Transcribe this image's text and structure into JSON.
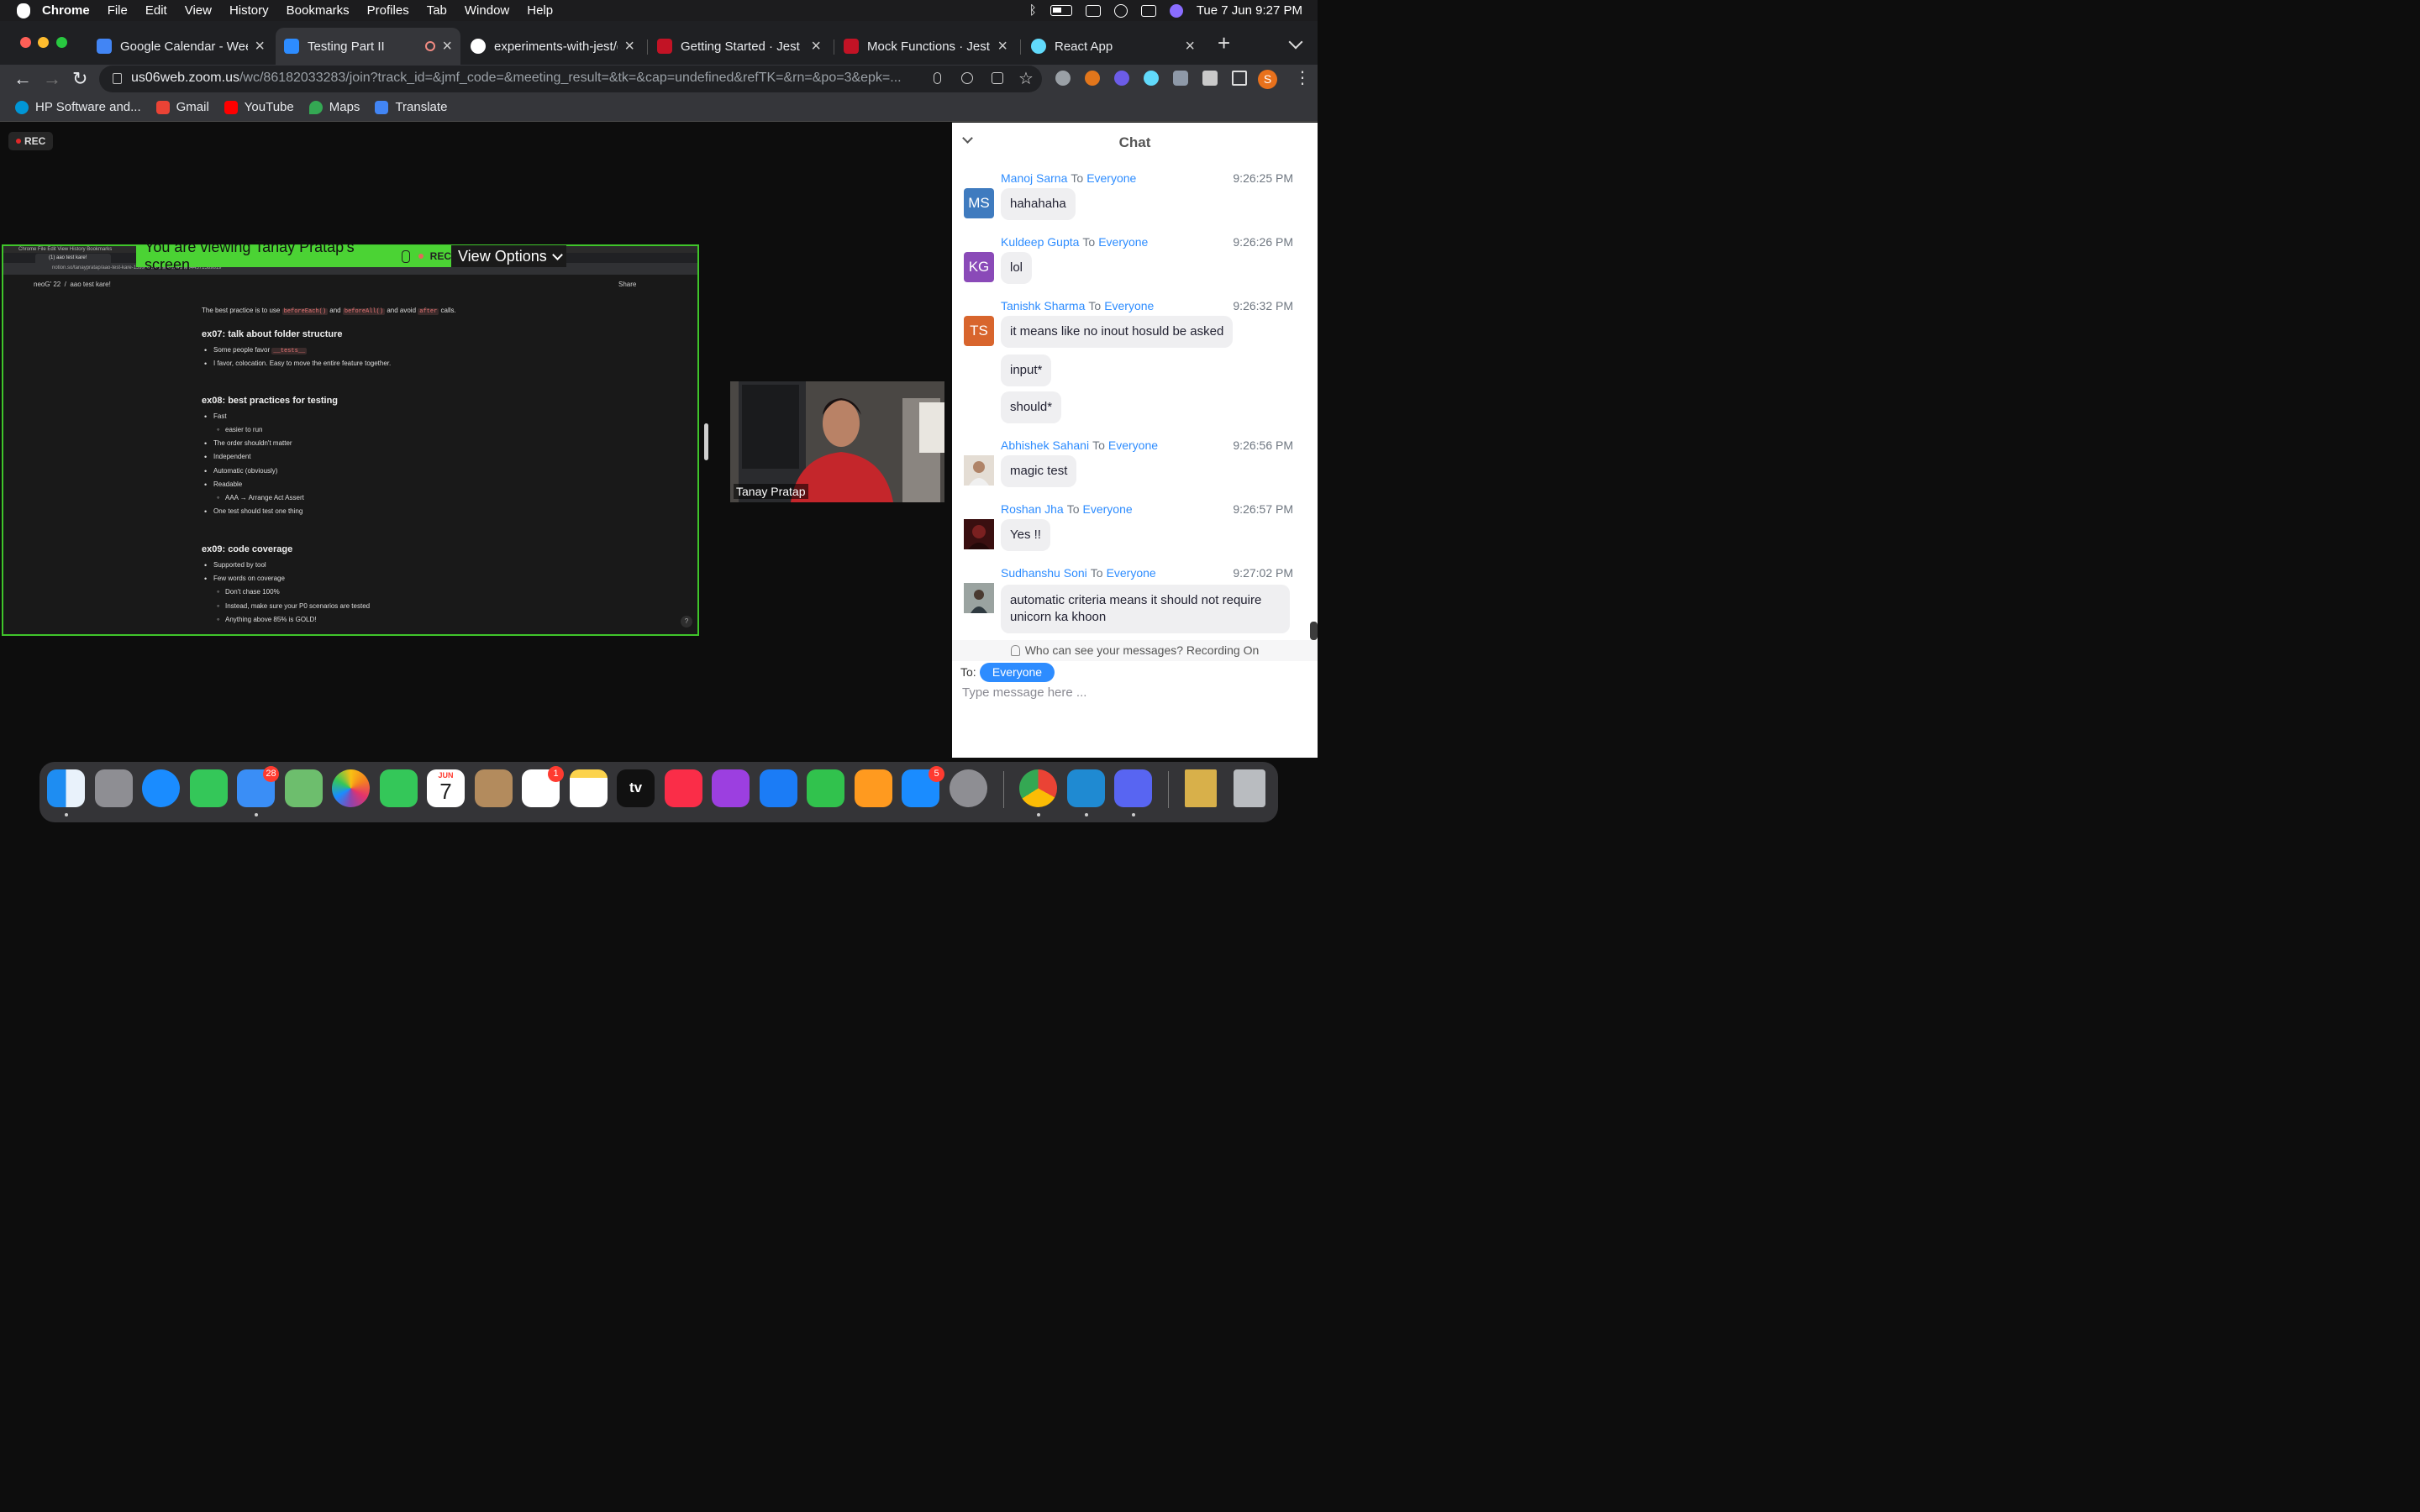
{
  "menubar": {
    "app": "Chrome",
    "items": [
      "File",
      "Edit",
      "View",
      "History",
      "Bookmarks",
      "Profiles",
      "Tab",
      "Window",
      "Help"
    ],
    "clock": "Tue 7 Jun  9:27 PM"
  },
  "tabs": [
    {
      "title": "Google Calendar - Week",
      "favicon_color": "#4285f4",
      "active": false
    },
    {
      "title": "Testing Part II",
      "favicon_color": "#2d8cff",
      "active": true
    },
    {
      "title": "experiments-with-jest/gr",
      "favicon_color": "#ffffff",
      "active": false
    },
    {
      "title": "Getting Started · Jest",
      "favicon_color": "#c21325",
      "active": false
    },
    {
      "title": "Mock Functions · Jest",
      "favicon_color": "#c21325",
      "active": false
    },
    {
      "title": "React App",
      "favicon_color": "#61dafb",
      "active": false
    }
  ],
  "address": {
    "host": "us06web.zoom.us",
    "path": "/wc/86182033283/join?track_id=&jmf_code=&meeting_result=&tk=&cap=undefined&refTK=&rn=&po=3&epk=..."
  },
  "profile_initial": "S",
  "bookmarks": [
    {
      "label": "HP Software and...",
      "color": "#0096d6"
    },
    {
      "label": "Gmail",
      "color": "#ea4335"
    },
    {
      "label": "YouTube",
      "color": "#ff0000"
    },
    {
      "label": "Maps",
      "color": "#34a853"
    },
    {
      "label": "Translate",
      "color": "#4285f4"
    }
  ],
  "zoom": {
    "rec_label": "REC",
    "share_banner": "You are viewing Tanay Pratap's screen",
    "share_rec": "REC",
    "view_options": "View Options",
    "speaker_name": "Tanay Pratap"
  },
  "shared_screen": {
    "menubar_text": "Chrome   File   Edit   View   History   Bookmarks",
    "tab_title": "(1) aao test kare!",
    "url": "notion.so/tanaypratap/aao-test-kare-1599c6180afa462ba1de944371589819",
    "crumb_1": "neoG' 22",
    "crumb_2": "aao test kare!",
    "share": "Share",
    "help": "?",
    "intro_1": "The best practice is to use",
    "code_1": "beforeEach()",
    "intro_2": "and",
    "code_2": "beforeAll()",
    "intro_3": "and avoid",
    "code_3": "after",
    "intro_4": "calls.",
    "ex07": "ex07: talk about folder structure",
    "ex07_b1": "Some people favor",
    "ex07_b1_code": "__tests__",
    "ex07_b2": "I favor, colocation. Easy to move the entire feature together.",
    "ex08": "ex08: best practices for testing",
    "ex08_items": [
      "Fast",
      "easier to run",
      "The order shouldn't matter",
      "Independent",
      "Automatic (obviously)",
      "Readable",
      "AAA → Arrange Act Assert",
      "One test should test one thing"
    ],
    "ex09": "ex09: code coverage",
    "ex09_items": [
      "Supported by tool",
      "Few words on coverage",
      "Don't chase 100%",
      "Instead, make sure your P0 scenarios are tested",
      "Anything above 85% is GOLD!"
    ]
  },
  "chat": {
    "title": "Chat",
    "to_word": "To",
    "messages": [
      {
        "from": "Manoj Sarna",
        "to": "Everyone",
        "time": "9:26:25 PM",
        "initials": "MS",
        "avatar_color": "#3f7bbf",
        "texts": [
          "hahahaha"
        ]
      },
      {
        "from": "Kuldeep Gupta",
        "to": "Everyone",
        "time": "9:26:26 PM",
        "initials": "KG",
        "avatar_color": "#8a4ab8",
        "texts": [
          "lol"
        ]
      },
      {
        "from": "Tanishk Sharma",
        "to": "Everyone",
        "time": "9:26:32 PM",
        "initials": "TS",
        "avatar_color": "#d8652d",
        "texts": [
          "it means like no inout hosuld be asked",
          "input*",
          "should*"
        ]
      },
      {
        "from": "Abhishek Sahani",
        "to": "Everyone",
        "time": "9:26:56 PM",
        "initials": "",
        "avatar_color": "#c9b7a3",
        "texts": [
          "magic test"
        ]
      },
      {
        "from": "Roshan Jha",
        "to": "Everyone",
        "time": "9:26:57 PM",
        "initials": "",
        "avatar_color": "#5a1a1a",
        "texts": [
          "Yes !!"
        ]
      },
      {
        "from": "Sudhanshu Soni",
        "to": "Everyone",
        "time": "9:27:02 PM",
        "initials": "",
        "avatar_color": "#5d6a6a",
        "texts": [
          "automatic criteria means it should not require unicorn ka khoon"
        ]
      }
    ],
    "notice": "Who can see your messages? Recording On",
    "to_label": "To:",
    "recipient": "Everyone",
    "input_placeholder": "Type message here ..."
  },
  "dock": {
    "calendar_month": "JUN",
    "calendar_day": "7",
    "mail_badge": "28",
    "reminders_badge": "1",
    "appstore_badge": "5",
    "tv_label": "tv"
  }
}
